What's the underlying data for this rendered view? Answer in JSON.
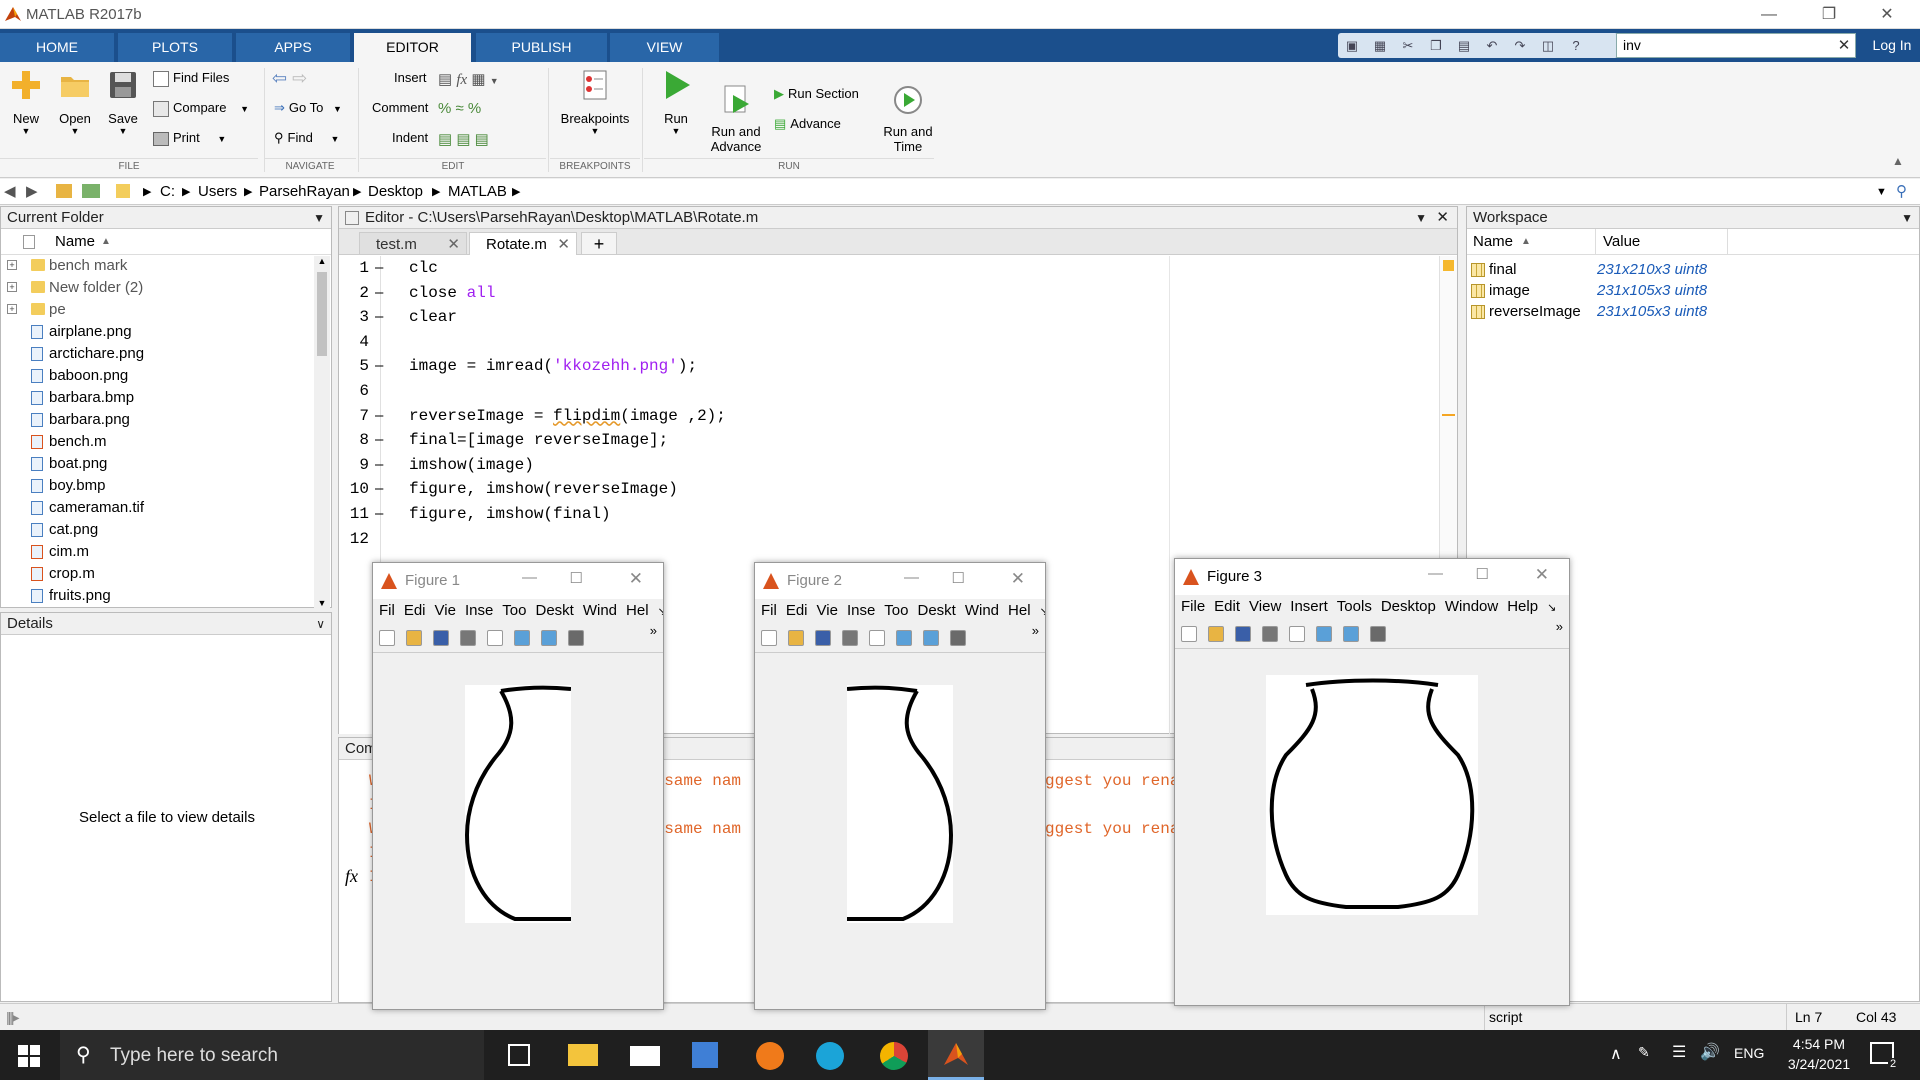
{
  "window": {
    "title": "MATLAB R2017b"
  },
  "tabs": [
    "HOME",
    "PLOTS",
    "APPS",
    "EDITOR",
    "PUBLISH",
    "VIEW"
  ],
  "active_tab": "EDITOR",
  "search": {
    "value": "inv"
  },
  "login_label": "Log In",
  "ribbon": {
    "file": {
      "section": "FILE",
      "new": "New",
      "open": "Open",
      "save": "Save",
      "find_files": "Find Files",
      "compare": "Compare",
      "print": "Print"
    },
    "navigate": {
      "section": "NAVIGATE",
      "go_to": "Go To",
      "find": "Find"
    },
    "edit": {
      "section": "EDIT",
      "insert": "Insert",
      "comment": "Comment",
      "indent": "Indent"
    },
    "breakpoints": {
      "section": "BREAKPOINTS",
      "label": "Breakpoints"
    },
    "run": {
      "section": "RUN",
      "run": "Run",
      "run_and_advance": "Run and\nAdvance",
      "run_section": "Run Section",
      "advance": "Advance",
      "run_and_time": "Run and\nTime"
    }
  },
  "address": {
    "parts": [
      "C:",
      "Users",
      "ParsehRayan",
      "Desktop",
      "MATLAB"
    ]
  },
  "current_folder": {
    "title": "Current Folder",
    "column": "Name",
    "items": [
      {
        "name": "bench mark",
        "type": "folder"
      },
      {
        "name": "New folder (2)",
        "type": "folder"
      },
      {
        "name": "pe",
        "type": "folder"
      },
      {
        "name": "airplane.png",
        "type": "file"
      },
      {
        "name": "arctichare.png",
        "type": "file"
      },
      {
        "name": "baboon.png",
        "type": "file"
      },
      {
        "name": "barbara.bmp",
        "type": "file"
      },
      {
        "name": "barbara.png",
        "type": "file"
      },
      {
        "name": "bench.m",
        "type": "mfile"
      },
      {
        "name": "boat.png",
        "type": "file"
      },
      {
        "name": "boy.bmp",
        "type": "file"
      },
      {
        "name": "cameraman.tif",
        "type": "file"
      },
      {
        "name": "cat.png",
        "type": "file"
      },
      {
        "name": "cim.m",
        "type": "mfile"
      },
      {
        "name": "crop.m",
        "type": "mfile"
      },
      {
        "name": "fruits.png",
        "type": "file"
      }
    ]
  },
  "details": {
    "title": "Details",
    "message": "Select a file to view details"
  },
  "editor": {
    "title": "Editor - C:\\Users\\ParsehRayan\\Desktop\\MATLAB\\Rotate.m",
    "tabs": [
      "test.m",
      "Rotate.m"
    ],
    "active_tab": "Rotate.m",
    "lines": [
      {
        "n": "1",
        "code": "clc"
      },
      {
        "n": "2",
        "code": "close all"
      },
      {
        "n": "3",
        "code": "clear"
      },
      {
        "n": "4",
        "code": ""
      },
      {
        "n": "5",
        "code": "image = imread('kkozehh.png');"
      },
      {
        "n": "6",
        "code": ""
      },
      {
        "n": "7",
        "code": "reverseImage = flipdim(image ,2);"
      },
      {
        "n": "8",
        "code": "final=[image reverseImage];"
      },
      {
        "n": "9",
        "code": "imshow(image)"
      },
      {
        "n": "10",
        "code": "figure, imshow(reverseImage)"
      },
      {
        "n": "11",
        "code": "figure, imshow(final)"
      },
      {
        "n": "12",
        "code": ""
      }
    ]
  },
  "command_window": {
    "title": "Com",
    "line1a": "e same nam",
    "line1b": "ggest you rena",
    "line2a": "e same nam",
    "line2b": "ggest you rena",
    "prompt": "fx"
  },
  "workspace": {
    "title": "Workspace",
    "col_name": "Name",
    "col_value": "Value",
    "vars": [
      {
        "name": "final",
        "value": "231x210x3 uint8"
      },
      {
        "name": "image",
        "value": "231x105x3 uint8"
      },
      {
        "name": "reverseImage",
        "value": "231x105x3 uint8"
      }
    ]
  },
  "figures": [
    {
      "title": "Figure 1",
      "menu": [
        "Fil",
        "Edi",
        "Vie",
        "Inse",
        "Too",
        "Deskt",
        "Wind",
        "Hel"
      ]
    },
    {
      "title": "Figure 2",
      "menu": [
        "Fil",
        "Edi",
        "Vie",
        "Inse",
        "Too",
        "Deskt",
        "Wind",
        "Hel"
      ]
    },
    {
      "title": "Figure 3",
      "menu": [
        "File",
        "Edit",
        "View",
        "Insert",
        "Tools",
        "Desktop",
        "Window",
        "Help"
      ]
    }
  ],
  "status": {
    "mode": "script",
    "ln": "Ln  7",
    "col": "Col  43"
  },
  "taskbar": {
    "search_placeholder": "Type here to search",
    "lang": "ENG",
    "time": "4:54 PM",
    "date": "3/24/2021",
    "notification_count": "2"
  }
}
